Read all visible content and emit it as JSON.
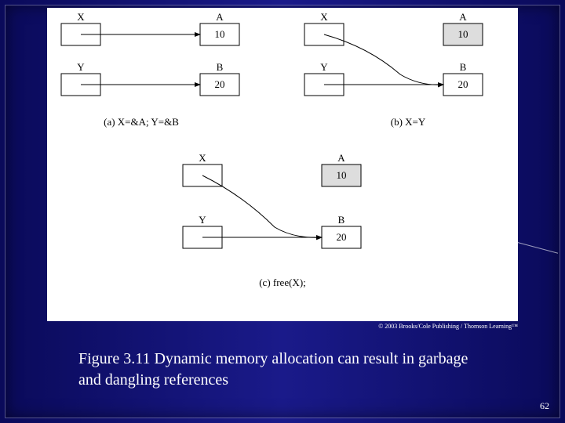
{
  "panels": {
    "a": {
      "X": "X",
      "Y": "Y",
      "A": "A",
      "B": "B",
      "valA": "10",
      "valB": "20",
      "caption": "(a) X=&A;  Y=&B"
    },
    "b": {
      "X": "X",
      "Y": "Y",
      "A": "A",
      "B": "B",
      "valA": "10",
      "valB": "20",
      "caption": "(b) X=Y"
    },
    "c": {
      "X": "X",
      "Y": "Y",
      "A": "A",
      "B": "B",
      "valA": "10",
      "valB": "20",
      "caption": "(c) free(X);"
    }
  },
  "copyright": "© 2003 Brooks/Cole Publishing / Thomson Learning™",
  "caption": "Figure 3.11  Dynamic memory allocation can result in garbage and dangling references",
  "page": "62"
}
